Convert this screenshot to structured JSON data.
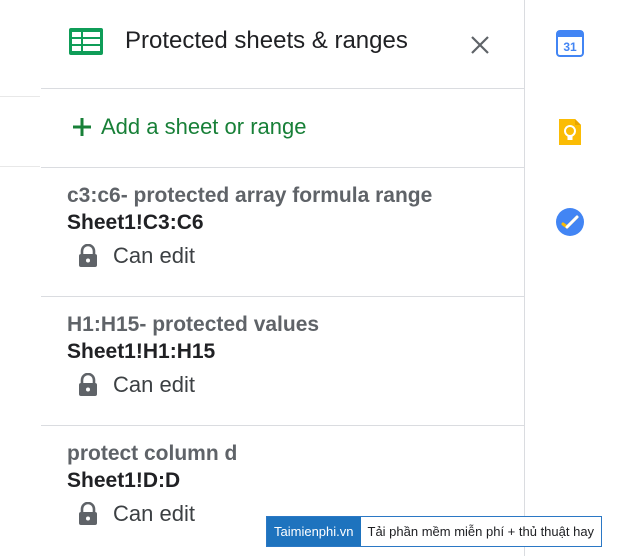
{
  "panel": {
    "title": "Protected sheets & ranges",
    "add_label": "Add a sheet or range"
  },
  "ranges": [
    {
      "description": "c3:c6- protected array formula range",
      "reference": "Sheet1!C3:C6",
      "permission": "Can edit"
    },
    {
      "description": "H1:H15- protected values",
      "reference": "Sheet1!H1:H15",
      "permission": "Can edit"
    },
    {
      "description": "protect column d",
      "reference": "Sheet1!D:D",
      "permission": "Can edit"
    }
  ],
  "side_rail": {
    "calendar_day": "31"
  },
  "watermark": {
    "brand": "Taimienphi.vn",
    "slogan": "Tải phần mềm miễn phí + thủ thuật hay"
  },
  "colors": {
    "accent_green": "#188038",
    "sheets_green": "#0f9d58",
    "calendar_blue": "#4285f4",
    "keep_yellow": "#fbbc04",
    "tasks_blue": "#4285f4",
    "watermark_blue": "#1e73be"
  }
}
